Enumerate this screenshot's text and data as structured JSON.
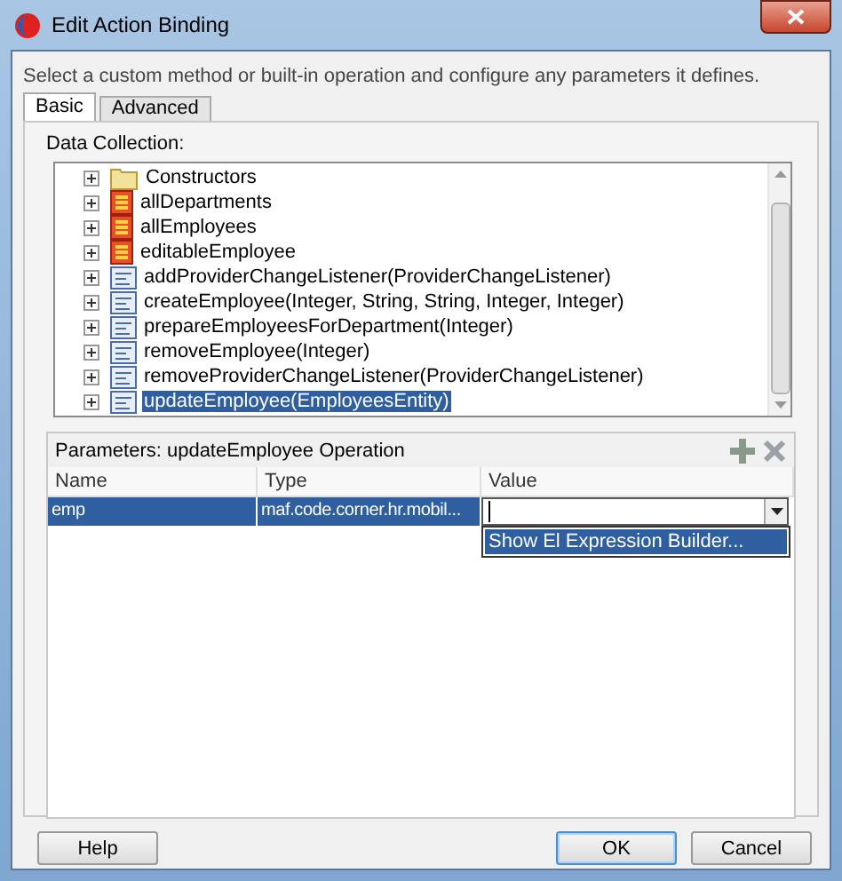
{
  "window": {
    "title": "Edit Action Binding"
  },
  "instructions": "Select a custom method or built-in operation and configure any parameters it defines.",
  "tabs": [
    {
      "label": "Basic",
      "selected": true
    },
    {
      "label": "Advanced",
      "selected": false
    }
  ],
  "data_collection": {
    "label": "Data Collection:",
    "items": [
      {
        "kind": "folder",
        "label": "Constructors",
        "selected": false
      },
      {
        "kind": "collection",
        "label": "allDepartments",
        "selected": false
      },
      {
        "kind": "collection",
        "label": "allEmployees",
        "selected": false
      },
      {
        "kind": "collection",
        "label": "editableEmployee",
        "selected": false
      },
      {
        "kind": "method",
        "label": "addProviderChangeListener(ProviderChangeListener)",
        "selected": false
      },
      {
        "kind": "method",
        "label": "createEmployee(Integer, String, String, Integer, Integer)",
        "selected": false
      },
      {
        "kind": "method",
        "label": "prepareEmployeesForDepartment(Integer)",
        "selected": false
      },
      {
        "kind": "method",
        "label": "removeEmployee(Integer)",
        "selected": false
      },
      {
        "kind": "method",
        "label": "removeProviderChangeListener(ProviderChangeListener)",
        "selected": false
      },
      {
        "kind": "method",
        "label": "updateEmployee(EmployeesEntity)",
        "selected": true
      }
    ]
  },
  "parameters": {
    "title": "Parameters:  updateEmployee Operation",
    "columns": [
      "Name",
      "Type",
      "Value"
    ],
    "rows": [
      {
        "name": "emp",
        "type": "maf.code.corner.hr.mobil...",
        "selected": true
      }
    ],
    "dropdown": [
      {
        "label": "Show El Expression Builder...",
        "selected": true
      }
    ]
  },
  "left_buttons": [
    {
      "label": "Help",
      "default": false
    }
  ],
  "right_buttons": [
    {
      "label": "OK",
      "default": true
    },
    {
      "label": "Cancel",
      "default": false
    }
  ]
}
